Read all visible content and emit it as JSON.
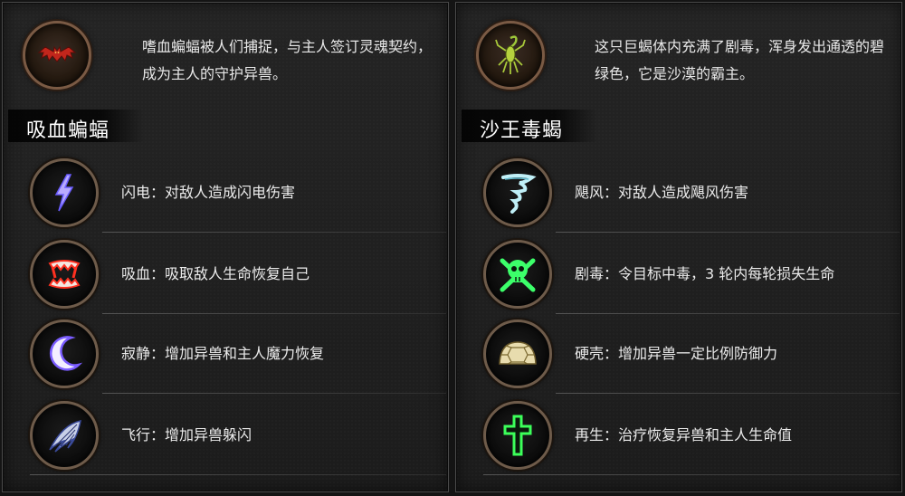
{
  "panels": [
    {
      "name": "吸血蝙蝠",
      "description": "嗜血蝙蝠被人们捕捉，与主人签订灵魂契约，成为主人的守护异兽。",
      "portrait_icon": "bat-icon",
      "skills": [
        {
          "label": "闪电：对敌人造成闪电伤害",
          "icon": "lightning-icon",
          "color": "#8a7cff"
        },
        {
          "label": "吸血：吸取敌人生命恢复自己",
          "icon": "fangs-icon",
          "color": "#ff3a2a"
        },
        {
          "label": "寂静：增加异兽和主人魔力恢复",
          "icon": "crescent-moon-icon",
          "color": "#8a6cff"
        },
        {
          "label": "飞行：增加异兽躲闪",
          "icon": "wing-icon",
          "color": "#7a8cff"
        }
      ]
    },
    {
      "name": "沙王毒蝎",
      "description": "这只巨蝎体内充满了剧毒，浑身发出通透的碧绿色，它是沙漠的霸主。",
      "portrait_icon": "scorpion-icon",
      "skills": [
        {
          "label": "飓风：对敌人造成飓风伤害",
          "icon": "tornado-icon",
          "color": "#7fd8e8"
        },
        {
          "label": "剧毒：令目标中毒，3 轮内每轮损失生命",
          "icon": "skull-crossbones-icon",
          "color": "#3cff6a"
        },
        {
          "label": "硬壳：增加异兽一定比例防御力",
          "icon": "turtle-shell-icon",
          "color": "#e8dcae"
        },
        {
          "label": "再生：治疗恢复异兽和主人生命值",
          "icon": "cross-icon",
          "color": "#3cff5a"
        }
      ]
    }
  ]
}
